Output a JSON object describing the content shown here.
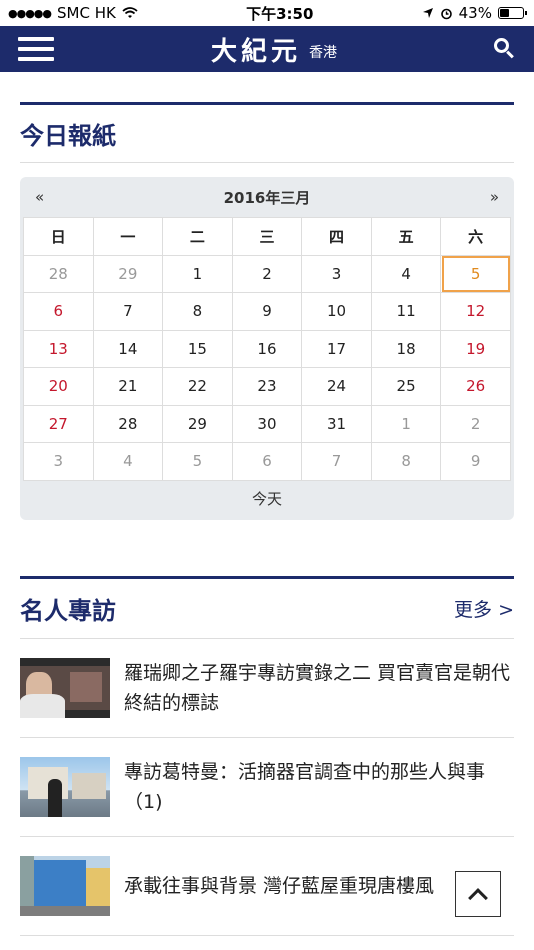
{
  "status_bar": {
    "carrier": "SMC HK",
    "time": "下午3:50",
    "battery": "43%",
    "battery_level": 0.43
  },
  "header": {
    "logo": "大紀元",
    "region": "香港"
  },
  "newspaper": {
    "title": "今日報紙",
    "calendar": {
      "prev": "«",
      "next": "»",
      "month_label": "2016年三月",
      "weekdays": [
        "日",
        "一",
        "二",
        "三",
        "四",
        "五",
        "六"
      ],
      "weeks": [
        [
          "28",
          "29",
          "1",
          "2",
          "3",
          "4",
          "5"
        ],
        [
          "6",
          "7",
          "8",
          "9",
          "10",
          "11",
          "12"
        ],
        [
          "13",
          "14",
          "15",
          "16",
          "17",
          "18",
          "19"
        ],
        [
          "20",
          "21",
          "22",
          "23",
          "24",
          "25",
          "26"
        ],
        [
          "27",
          "28",
          "29",
          "30",
          "31",
          "1",
          "2"
        ],
        [
          "3",
          "4",
          "5",
          "6",
          "7",
          "8",
          "9"
        ]
      ],
      "today_button": "今天"
    }
  },
  "interviews": {
    "title": "名人專訪",
    "more": "更多 >",
    "articles": [
      {
        "title": "羅瑞卿之子羅宇專訪實錄之二 買官賣官是朝代終結的標誌"
      },
      {
        "title": "專訪葛特曼：活摘器官調查中的那些人與事（1)"
      },
      {
        "title": "承載往事與背景 灣仔藍屋重現唐樓風"
      }
    ]
  },
  "colors": {
    "brand": "#1d2b6b",
    "weekend": "#c4172c",
    "today": "#e08a1e"
  }
}
